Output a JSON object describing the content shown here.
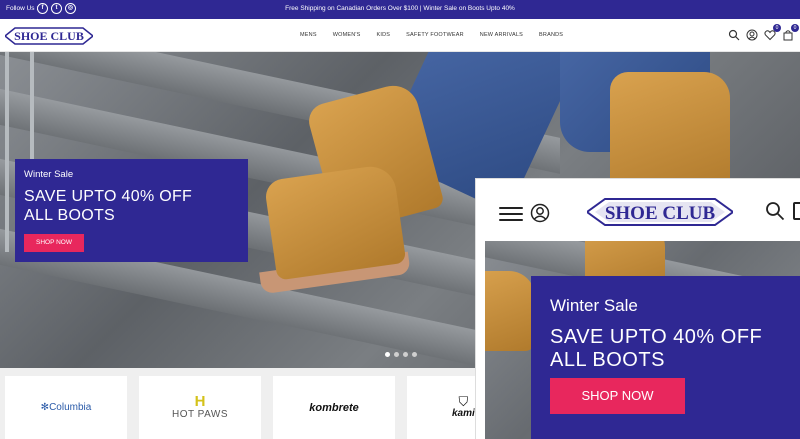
{
  "topbar": {
    "follow_label": "Follow Us :",
    "social_icons": [
      "facebook-icon",
      "twitter-icon",
      "instagram-icon"
    ],
    "social_glyphs": [
      "f",
      "t",
      "◎"
    ],
    "promo_text": "Free Shipping on Canadian Orders Over $100 | Winter Sale on Boots Upto 40%"
  },
  "header": {
    "logo_text": "SHOE CLUB",
    "nav": [
      "MENS",
      "WOMEN'S",
      "KIDS",
      "SAFETY FOOTWEAR",
      "NEW ARRIVALS",
      "BRANDS"
    ],
    "wishlist_count": "0",
    "cart_count": "0"
  },
  "hero": {
    "subtitle": "Winter Sale",
    "title_line1": "SAVE UPTO 40% OFF",
    "title_line2": "ALL BOOTS",
    "button": "SHOP NOW",
    "slides": 4,
    "active_slide": 1
  },
  "brands": [
    "Columbia",
    "HOT PAWS",
    "kombrete",
    "kami"
  ],
  "mobile": {
    "logo_text": "SHOE CLUB",
    "subtitle": "Winter Sale",
    "title_line1": "SAVE UPTO 40% OFF",
    "title_line2": "ALL BOOTS",
    "button": "SHOP NOW"
  },
  "colors": {
    "brand": "#2f2893",
    "accent": "#e8275d"
  }
}
